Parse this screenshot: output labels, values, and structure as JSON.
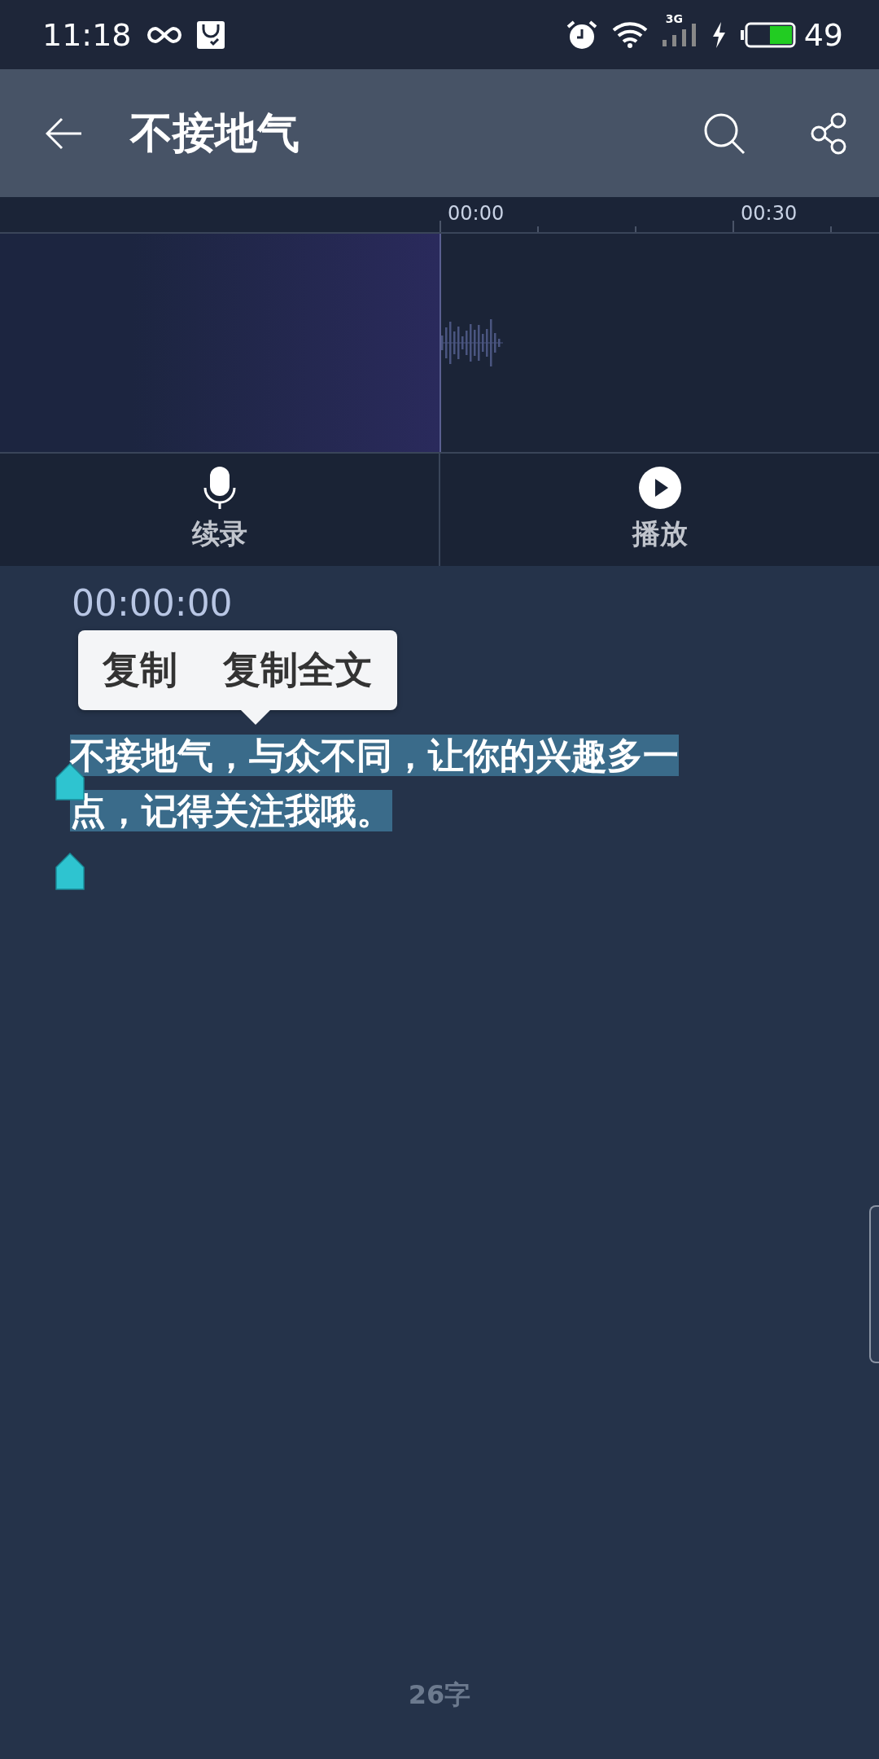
{
  "status_bar": {
    "time": "11:18",
    "network": "3G",
    "battery": "49"
  },
  "toolbar": {
    "title": "不接地气"
  },
  "timeline": {
    "ticks": [
      "00:00",
      "00:30"
    ]
  },
  "controls": [
    {
      "kind": "record",
      "label": "续录"
    },
    {
      "kind": "play",
      "label": "播放"
    }
  ],
  "transcript": {
    "timestamp": "00:00:00",
    "text": "不接地气，与众不同，让你的兴趣多一点，记得关注我哦。",
    "selected": true
  },
  "context_menu": {
    "items": [
      "复制",
      "复制全文"
    ]
  },
  "footer": {
    "word_count": "26字"
  }
}
